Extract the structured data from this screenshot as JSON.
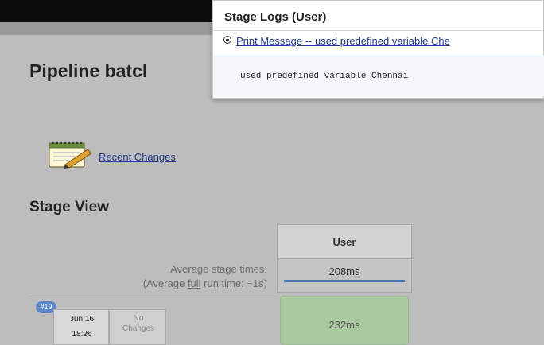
{
  "page": {
    "title": "Pipeline batcl",
    "recent_changes_label": "Recent Changes",
    "stage_view_title": "Stage View"
  },
  "stage_view": {
    "stage_header": "User",
    "avg_label_line1": "Average stage times:",
    "avg_label_prefix": "(Average ",
    "avg_label_full": "full",
    "avg_label_suffix": " run time: ~1s)",
    "avg_value": "208ms",
    "builds": [
      {
        "badge": "#19",
        "date": "Jun 16",
        "time": "18:26",
        "changes_line1": "No",
        "changes_line2": "Changes",
        "stage_value": "232ms"
      }
    ]
  },
  "popup": {
    "title": "Stage Logs (User)",
    "step_label": "Print Message -- used predefined variable Che",
    "log_text": "used predefined variable Chennai"
  },
  "colors": {
    "top_bar": "#0d0d0d",
    "link": "#1f3a8a",
    "progress": "#4a77b8",
    "success_cell": "#a9c9a0",
    "badge": "#5a86c5"
  }
}
